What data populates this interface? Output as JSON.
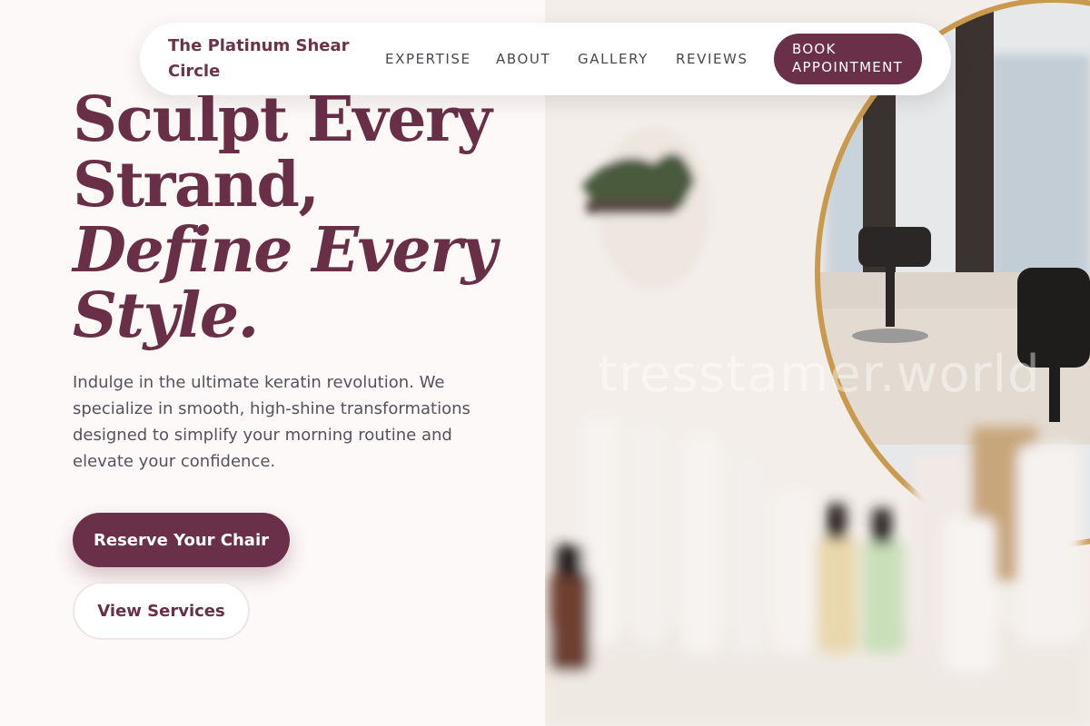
{
  "nav": {
    "brand": "The Platinum Shear Circle",
    "links": [
      "EXPERTISE",
      "ABOUT",
      "GALLERY",
      "REVIEWS"
    ],
    "cta": "BOOK APPOINTMENT"
  },
  "hero": {
    "headline_line1": "Sculpt Every",
    "headline_line2": "Strand,",
    "headline_line3": "Define Every",
    "headline_line4": "Style.",
    "lede": "Indulge in the ultimate keratin revolution. We specialize in smooth, high-shine transformations designed to simplify your morning routine and elevate your confidence.",
    "primary_button": "Reserve Your Chair",
    "secondary_button": "View Services"
  },
  "photo": {
    "watermark": "tresstamer.world"
  },
  "colors": {
    "brand": "#6a3049",
    "background": "#fdf9f8",
    "text": "#56525c"
  }
}
